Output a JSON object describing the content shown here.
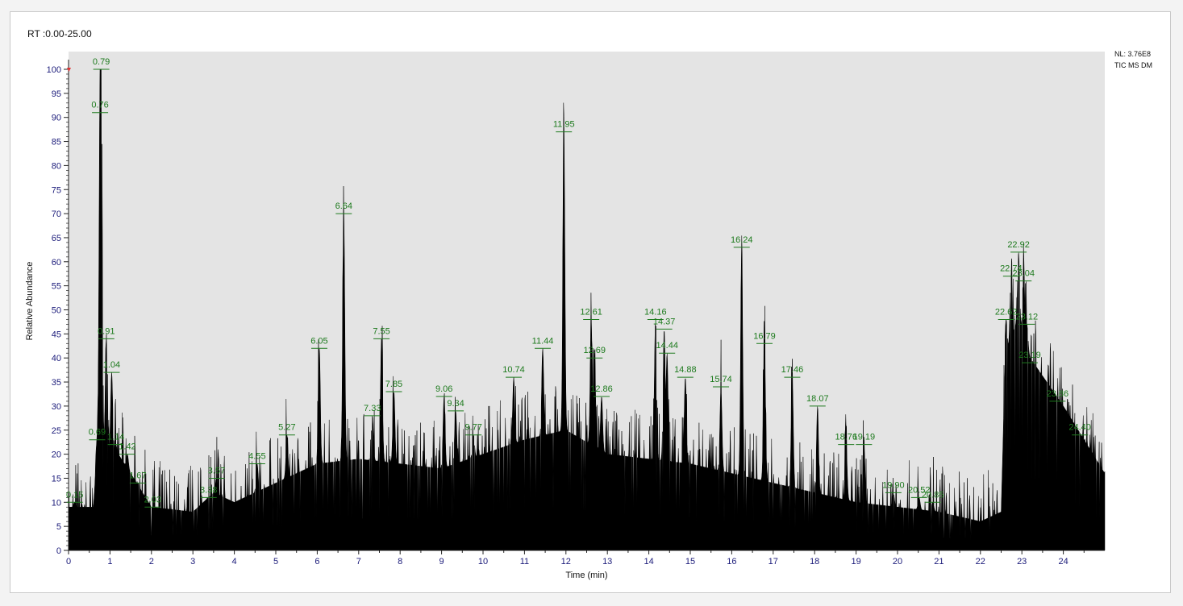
{
  "header": {
    "rt_range": "RT :0.00-25.00",
    "nl": "NL: 3.76E8",
    "mode": "TIC  MS  DM"
  },
  "colors": {
    "plot_bg": "#e4e4e4",
    "trace": "#000000",
    "axis_labels": "#1b1b7a",
    "peak_labels": "#1d7a1d"
  },
  "chart_data": {
    "type": "line",
    "xlabel": "Time (min)",
    "ylabel": "Relative Abundance",
    "xlim": [
      0,
      25
    ],
    "ylim": [
      0,
      100
    ],
    "x_ticks": [
      0,
      1,
      2,
      3,
      4,
      5,
      6,
      7,
      8,
      9,
      10,
      11,
      12,
      13,
      14,
      15,
      16,
      17,
      18,
      19,
      20,
      21,
      22,
      23,
      24
    ],
    "y_ticks": [
      0,
      5,
      10,
      15,
      20,
      25,
      30,
      35,
      40,
      45,
      50,
      55,
      60,
      65,
      70,
      75,
      80,
      85,
      90,
      95,
      100
    ],
    "grid": false,
    "peaks": [
      {
        "label": "0.15",
        "rt": 0.15,
        "value": 10
      },
      {
        "label": "0.69",
        "rt": 0.69,
        "value": 23
      },
      {
        "label": "0.76",
        "rt": 0.76,
        "value": 91
      },
      {
        "label": "0.79",
        "rt": 0.79,
        "value": 100
      },
      {
        "label": "0.91",
        "rt": 0.91,
        "value": 44
      },
      {
        "label": "1.04",
        "rt": 1.04,
        "value": 37
      },
      {
        "label": "1.14",
        "rt": 1.14,
        "value": 22
      },
      {
        "label": "1.42",
        "rt": 1.42,
        "value": 20
      },
      {
        "label": "1.67",
        "rt": 1.67,
        "value": 14
      },
      {
        "label": "2.03",
        "rt": 2.03,
        "value": 9
      },
      {
        "label": "3.38",
        "rt": 3.38,
        "value": 11
      },
      {
        "label": "3.57",
        "rt": 3.57,
        "value": 15
      },
      {
        "label": "4.55",
        "rt": 4.55,
        "value": 18
      },
      {
        "label": "5.27",
        "rt": 5.27,
        "value": 24
      },
      {
        "label": "6.05",
        "rt": 6.05,
        "value": 42
      },
      {
        "label": "6.64",
        "rt": 6.64,
        "value": 70
      },
      {
        "label": "7.33",
        "rt": 7.33,
        "value": 28
      },
      {
        "label": "7.55",
        "rt": 7.55,
        "value": 44
      },
      {
        "label": "7.85",
        "rt": 7.85,
        "value": 33
      },
      {
        "label": "9.06",
        "rt": 9.06,
        "value": 32
      },
      {
        "label": "9.34",
        "rt": 9.34,
        "value": 29
      },
      {
        "label": "9.77",
        "rt": 9.77,
        "value": 24
      },
      {
        "label": "10.74",
        "rt": 10.74,
        "value": 36
      },
      {
        "label": "11.44",
        "rt": 11.44,
        "value": 42
      },
      {
        "label": "11.95",
        "rt": 11.95,
        "value": 87
      },
      {
        "label": "12.61",
        "rt": 12.61,
        "value": 48
      },
      {
        "label": "12.69",
        "rt": 12.69,
        "value": 40
      },
      {
        "label": "12.86",
        "rt": 12.86,
        "value": 32
      },
      {
        "label": "14.16",
        "rt": 14.16,
        "value": 48
      },
      {
        "label": "14.37",
        "rt": 14.37,
        "value": 46
      },
      {
        "label": "14.44",
        "rt": 14.44,
        "value": 41
      },
      {
        "label": "14.88",
        "rt": 14.88,
        "value": 36
      },
      {
        "label": "15.74",
        "rt": 15.74,
        "value": 34
      },
      {
        "label": "16.24",
        "rt": 16.24,
        "value": 63
      },
      {
        "label": "16.79",
        "rt": 16.79,
        "value": 43
      },
      {
        "label": "17.46",
        "rt": 17.46,
        "value": 36
      },
      {
        "label": "18.07",
        "rt": 18.07,
        "value": 30
      },
      {
        "label": "18.76",
        "rt": 18.76,
        "value": 22
      },
      {
        "label": "19.19",
        "rt": 19.19,
        "value": 22
      },
      {
        "label": "19.90",
        "rt": 19.9,
        "value": 12
      },
      {
        "label": "20.52",
        "rt": 20.52,
        "value": 11
      },
      {
        "label": "20.85",
        "rt": 20.85,
        "value": 10
      },
      {
        "label": "22.62",
        "rt": 22.62,
        "value": 48
      },
      {
        "label": "22.74",
        "rt": 22.74,
        "value": 57
      },
      {
        "label": "22.92",
        "rt": 22.92,
        "value": 62
      },
      {
        "label": "23.04",
        "rt": 23.04,
        "value": 56
      },
      {
        "label": "23.12",
        "rt": 23.12,
        "value": 47
      },
      {
        "label": "23.19",
        "rt": 23.19,
        "value": 39
      },
      {
        "label": "23.86",
        "rt": 23.86,
        "value": 31
      },
      {
        "label": "24.40",
        "rt": 24.4,
        "value": 24
      }
    ],
    "baseline": [
      [
        0.0,
        9
      ],
      [
        0.6,
        9
      ],
      [
        0.7,
        20
      ],
      [
        1.2,
        20
      ],
      [
        1.5,
        16
      ],
      [
        2.0,
        9
      ],
      [
        3.0,
        8
      ],
      [
        3.5,
        12
      ],
      [
        4.0,
        10
      ],
      [
        5.0,
        14
      ],
      [
        6.0,
        18
      ],
      [
        7.0,
        19
      ],
      [
        8.0,
        18
      ],
      [
        9.0,
        17
      ],
      [
        10.0,
        20
      ],
      [
        11.0,
        23
      ],
      [
        12.0,
        25
      ],
      [
        13.0,
        20
      ],
      [
        14.0,
        19
      ],
      [
        15.0,
        18
      ],
      [
        16.0,
        16
      ],
      [
        17.0,
        14
      ],
      [
        18.0,
        12
      ],
      [
        19.0,
        10
      ],
      [
        20.0,
        9
      ],
      [
        21.0,
        8
      ],
      [
        22.0,
        6
      ],
      [
        22.5,
        8
      ],
      [
        22.6,
        40
      ],
      [
        22.9,
        48
      ],
      [
        23.2,
        40
      ],
      [
        24.0,
        30
      ],
      [
        25.0,
        16
      ]
    ]
  }
}
